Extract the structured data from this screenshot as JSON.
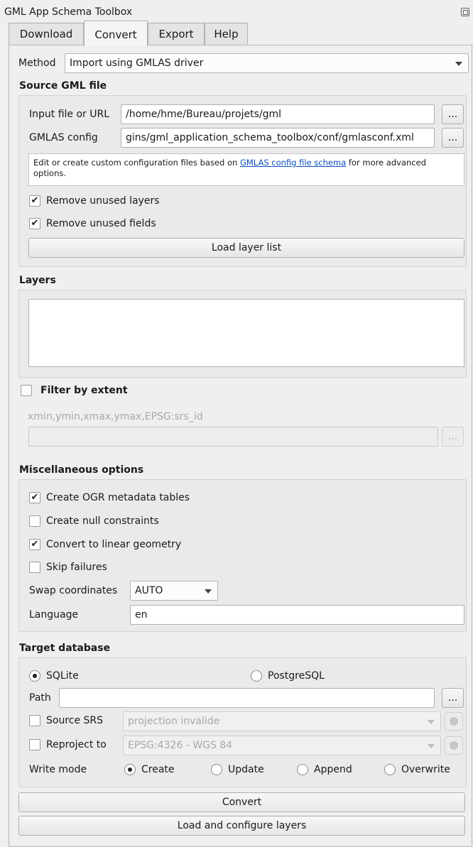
{
  "window": {
    "title": "GML App Schema Toolbox"
  },
  "tabs": [
    "Download",
    "Convert",
    "Export",
    "Help"
  ],
  "method": {
    "label": "Method",
    "value": "Import using GMLAS driver"
  },
  "source": {
    "title": "Source GML file",
    "input_label": "Input file or URL",
    "input_value": "/home/hme/Bureau/projets/gml",
    "config_label": "GMLAS config",
    "config_value": "gins/gml_application_schema_toolbox/conf/gmlasconf.xml",
    "browse": "...",
    "info_before": "Edit or create custom configuration files based on ",
    "info_link": "GMLAS config file schema",
    "info_after": " for more advanced options.",
    "remove_layers": "Remove unused layers",
    "remove_fields": "Remove unused fields",
    "load_button": "Load layer list"
  },
  "layers": {
    "title": "Layers"
  },
  "filter": {
    "title": "Filter by extent",
    "hint": "xmin,ymin,xmax,ymax,EPSG:srs_id",
    "browse": "..."
  },
  "misc": {
    "title": "Miscellaneous options",
    "ogr_metadata": "Create OGR metadata tables",
    "null_constraints": "Create null constraints",
    "linear_geometry": "Convert to linear geometry",
    "skip_failures": "Skip failures",
    "swap_label": "Swap coordinates",
    "swap_value": "AUTO",
    "language_label": "Language",
    "language_value": "en"
  },
  "target": {
    "title": "Target database",
    "sqlite": "SQLite",
    "postgres": "PostgreSQL",
    "path_label": "Path",
    "browse": "...",
    "source_srs_label": "Source SRS",
    "source_srs_value": "projection invalide",
    "reproject_label": "Reproject to",
    "reproject_value": "EPSG:4326 - WGS 84",
    "write_mode_label": "Write mode",
    "mode_create": "Create",
    "mode_update": "Update",
    "mode_append": "Append",
    "mode_overwrite": "Overwrite"
  },
  "buttons": {
    "convert": "Convert",
    "load_configure": "Load and configure layers"
  },
  "icons": {
    "check": "✔"
  }
}
